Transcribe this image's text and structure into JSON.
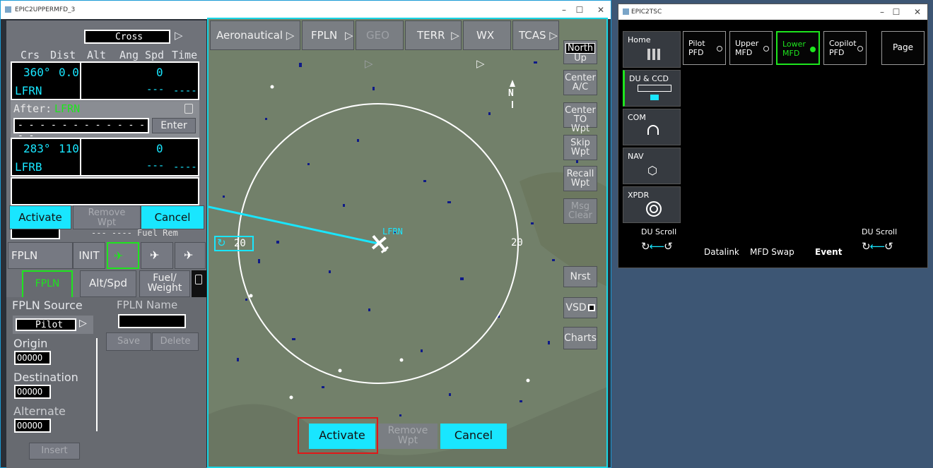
{
  "mfd": {
    "title": "EPIC2UPPERMFD_3",
    "cross_label": "Cross",
    "headers": [
      "Crs",
      "Dist",
      "Alt",
      "Ang",
      "Spd",
      "Time"
    ],
    "leg1": {
      "crs": "360°",
      "dist": "0.0",
      "ident": "LFRN",
      "ang": "0",
      "spd": "---",
      "time": "----"
    },
    "after_label": "After:",
    "after_ident": "LFRN",
    "entry_dashes": "- - - - - - - - - - - - - -",
    "enter_label": "Enter",
    "leg2": {
      "crs": "283°",
      "dist": "110",
      "ident": "LFRB",
      "ang": "0",
      "spd": "---",
      "time": "----"
    },
    "popup": {
      "activate": "Activate",
      "remove_l1": "Remove",
      "remove_l2": "Wpt",
      "cancel": "Cancel"
    },
    "partial_text": "---   ----  Fuel Rem",
    "tabs": {
      "fpln": "FPLN",
      "init": "INIT"
    },
    "subtabs": {
      "fpln": "FPLN",
      "altspd": "Alt/Spd",
      "fuel_l1": "Fuel/",
      "fuel_l2": "Weight"
    },
    "lower": {
      "source_label": "FPLN Source",
      "source_value": "Pilot",
      "name_label": "FPLN Name",
      "save": "Save",
      "delete": "Delete",
      "origin_label": "Origin",
      "origin_value": "OOOOO",
      "dest_label": "Destination",
      "dest_value": "OOOOO",
      "alt_label": "Alternate",
      "alt_value": "OOOOO",
      "insert": "Insert"
    }
  },
  "map": {
    "top_buttons": [
      "Aeronautical",
      "FPLN",
      "GEO",
      "TERR",
      "WX",
      "TCAS"
    ],
    "north_l1": "North",
    "north_l2": "Up",
    "side_buttons": [
      {
        "l1": "Center",
        "l2": "A/C"
      },
      {
        "l1": "Center",
        "l2": "TO Wpt"
      },
      {
        "l1": "Skip",
        "l2": "Wpt"
      },
      {
        "l1": "Recall",
        "l2": "Wpt"
      },
      {
        "l1": "Msg",
        "l2": "Clear"
      }
    ],
    "nrst": "Nrst",
    "vsd": "VSD",
    "charts": "Charts",
    "range_left": "20",
    "range_right": "20",
    "waypoint": "LFRN",
    "north_marker": "N",
    "activate": "Activate",
    "remove_l1": "Remove",
    "remove_l2": "Wpt",
    "cancel": "Cancel"
  },
  "tsc": {
    "title": "EPIC2TSC",
    "side": [
      "Home",
      "DU & CCD",
      "COM",
      "NAV",
      "XPDR"
    ],
    "top": [
      {
        "l1": "Pilot",
        "l2": "PFD"
      },
      {
        "l1": "Upper",
        "l2": "MFD"
      },
      {
        "l1": "Lower",
        "l2": "MFD"
      },
      {
        "l1": "Copilot",
        "l2": "PFD"
      }
    ],
    "page": "Page",
    "du_scroll_left": "DU Scroll",
    "du_scroll_right": "DU Scroll",
    "datalink": "Datalink",
    "mfd_swap": "MFD Swap",
    "event": "Event"
  }
}
